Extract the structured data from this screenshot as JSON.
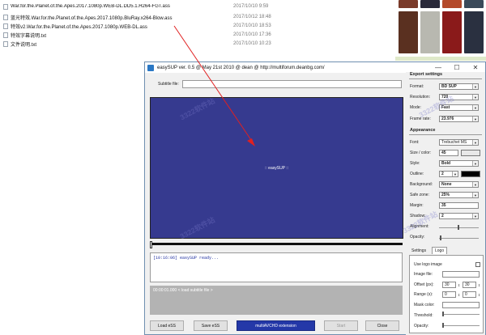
{
  "explorer": {
    "files": [
      {
        "name": "War.for.the.Planet.of.the.Apes.2017.1080p.WEB-DL.DD5.1.H264-FGT.ass",
        "date": "2017/10/10 9:59"
      },
      {
        "name": "蓝光特效.War.for.the.Planet.of.the.Apes.2017.1080p.BluRay.x264-Blow.ass",
        "date": "2017/10/12 18:48"
      },
      {
        "name": "特效v2.War.for.the.Planet.of.the.Apes.2017.1080p.WEB-DL.ass",
        "date": "2017/10/10 18:53"
      },
      {
        "name": "特效字幕说明.txt",
        "date": "2017/10/10 17:36"
      },
      {
        "name": "文件说明.txt",
        "date": "2017/10/10 10:23"
      }
    ]
  },
  "window": {
    "title": "easySUP ver. 0.5 @ May 21st 2010 @ dean @ http://multiforum.deanbg.com/",
    "minimize": "—",
    "maximize": "☐",
    "close": "✕"
  },
  "subtitle": {
    "label": "Subtitle file:",
    "value": ""
  },
  "preview": {
    "text": ":: easySUP ::"
  },
  "log": {
    "line": "[10:16:06] easySUP ready..."
  },
  "status": {
    "text": "00:00:01.000 < load subtitle file >"
  },
  "buttons": {
    "load": "Load eSS",
    "save": "Save eSS",
    "extension": "multiAVCHD extension",
    "start": "Start",
    "close": "Close"
  },
  "export": {
    "title": "Export settings",
    "format_label": "Format:",
    "format": "BD SUP",
    "resolution_label": "Resolution:",
    "resolution": "720",
    "mode_label": "Mode:",
    "mode": "Fast",
    "framerate_label": "Frame rate:",
    "framerate": "23.976"
  },
  "appearance": {
    "title": "Appearance",
    "font_label": "Font:",
    "font": "Trebuchet MS",
    "size_label": "Size / color:",
    "size": "45",
    "size_color": "#e8e8e8",
    "style_label": "Style:",
    "style": "Bold",
    "outline_label": "Outline:",
    "outline": "2",
    "outline_color": "#000000",
    "background_label": "Background:",
    "background": "None",
    "safezone_label": "Safe zone:",
    "safezone": "25%",
    "margin_label": "Margin:",
    "margin": "35",
    "shadow_label": "Shadow:",
    "shadow": "2",
    "alignment_label": "Alignment:",
    "opacity_label": "Opacity:"
  },
  "tabs": {
    "settings": "Settings",
    "logo": "Logo"
  },
  "logo": {
    "use_label": "Use logo image",
    "image_label": "Image file:",
    "offset_label": "Offset (px):",
    "offset_x": "30",
    "offset_y": "30",
    "range_label": "Range (s):",
    "range_from": "0",
    "range_to": "0",
    "mask_label": "Mask color:",
    "threshold_label": "Threshold:",
    "opacity_label": "Opacity:"
  },
  "watermark": "3322软件站",
  "colors": {
    "preview_bg": "#363a8f",
    "extension_btn": "#2438a8",
    "arrow": "#e02020"
  }
}
